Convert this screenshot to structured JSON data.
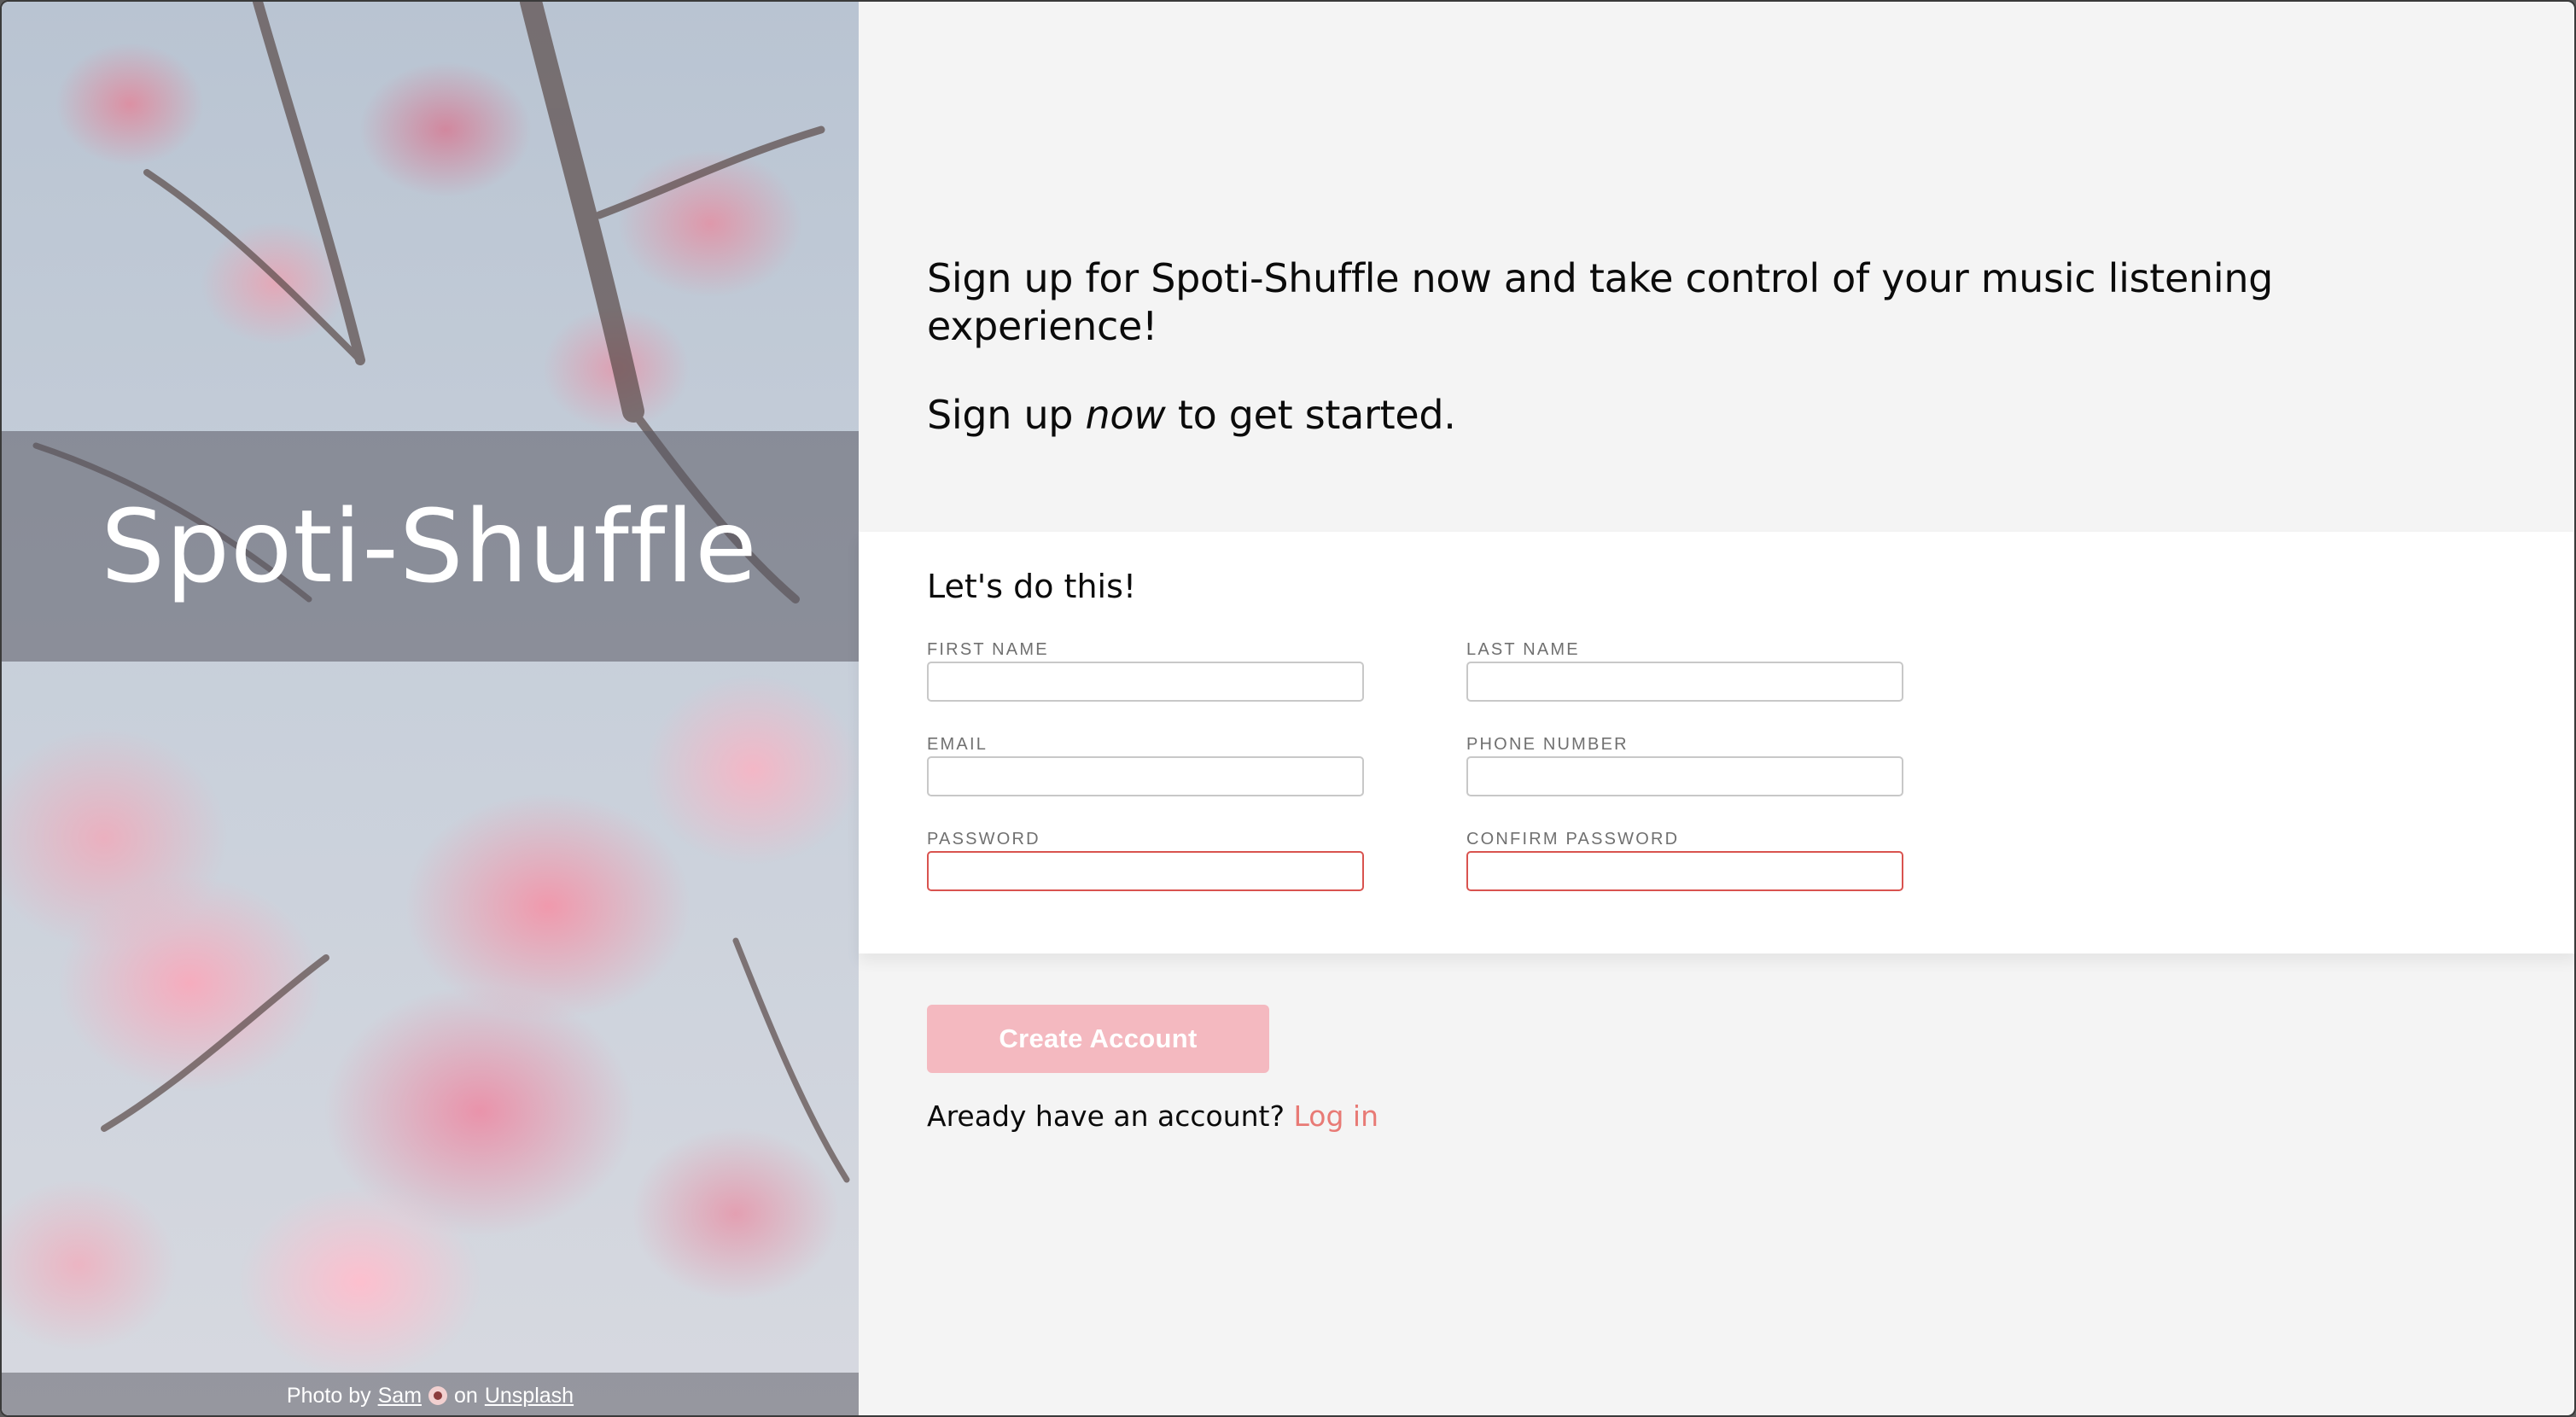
{
  "hero": {
    "brand": "Spoti-Shuffle",
    "credit": {
      "prefix": "Photo by",
      "author": "Sam",
      "middle": "on",
      "source": "Unsplash"
    }
  },
  "intro": {
    "headline": "Sign up for Spoti-Shuffle now and take control of your music listening experience!",
    "cta_before": "Sign up ",
    "cta_emphasis": "now",
    "cta_after": " to get started."
  },
  "form": {
    "title": "Let's do this!",
    "fields": {
      "first_name": {
        "label": "FIRST NAME",
        "value": ""
      },
      "last_name": {
        "label": "LAST NAME",
        "value": ""
      },
      "email": {
        "label": "EMAIL",
        "value": ""
      },
      "phone": {
        "label": "PHONE NUMBER",
        "value": ""
      },
      "password": {
        "label": "PASSWORD",
        "value": ""
      },
      "confirm_password": {
        "label": "CONFIRM PASSWORD",
        "value": ""
      }
    }
  },
  "actions": {
    "create_label": "Create Account",
    "login_prompt": "Aready have an account?",
    "login_link": "Log in"
  },
  "colors": {
    "accent": "#e87a75",
    "button_disabled": "#f4b9c0",
    "error_border": "#d9534f",
    "panel_bg": "#f4f4f4"
  },
  "icons": [
    "camera-emoji-icon"
  ]
}
